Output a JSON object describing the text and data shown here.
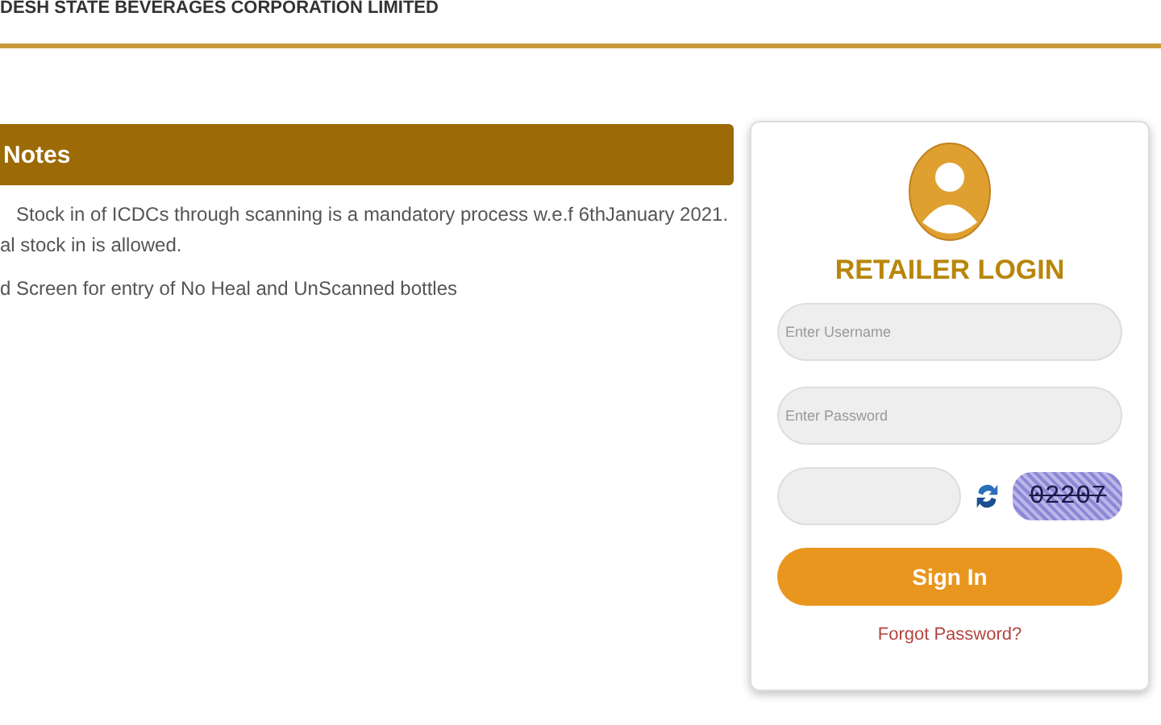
{
  "header": {
    "title": "DESH STATE BEVERAGES CORPORATION LIMITED"
  },
  "notes": {
    "title": "Notes",
    "lines": [
      "Stock in of ICDCs through scanning is a mandatory process w.e.f 6thJanuary 2021.",
      "al stock in is allowed.",
      "d Screen for entry of No Heal and UnScanned bottles"
    ]
  },
  "login": {
    "title": "RETAILER LOGIN",
    "username": {
      "placeholder": "Enter Username"
    },
    "password": {
      "placeholder": "Enter Password"
    },
    "captcha": "02207",
    "sign_in": "Sign In",
    "forgot": "Forgot Password?"
  }
}
